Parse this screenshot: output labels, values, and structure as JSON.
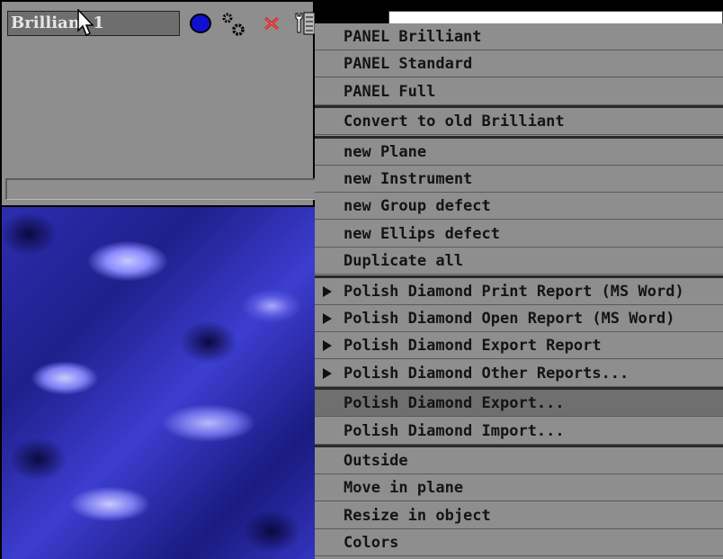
{
  "title_field": {
    "value": "Brilliant 1"
  },
  "toolbar": {
    "icons": [
      "blue-circle-icon",
      "gears-icon",
      "red-x-icon",
      "wrench-icon",
      "dots-icon"
    ]
  },
  "menu": {
    "groups": [
      {
        "items": [
          {
            "label": "PANEL Brilliant"
          },
          {
            "label": "PANEL Standard"
          },
          {
            "label": "PANEL Full"
          }
        ]
      },
      {
        "items": [
          {
            "label": "Convert to old Brilliant"
          }
        ]
      },
      {
        "items": [
          {
            "label": "new Plane"
          },
          {
            "label": "new Instrument"
          },
          {
            "label": "new Group defect"
          },
          {
            "label": "new Ellips defect"
          },
          {
            "label": "Duplicate all"
          }
        ]
      },
      {
        "items": [
          {
            "label": "Polish Diamond Print Report (MS Word)",
            "submenu": true
          },
          {
            "label": "Polish Diamond Open Report (MS Word)",
            "submenu": true
          },
          {
            "label": "Polish Diamond Export Report",
            "submenu": true
          },
          {
            "label": "Polish Diamond Other Reports...",
            "submenu": true
          }
        ]
      },
      {
        "items": [
          {
            "label": "Polish Diamond Export...",
            "highlighted": true
          },
          {
            "label": "Polish Diamond Import..."
          }
        ]
      },
      {
        "items": [
          {
            "label": "Outside"
          },
          {
            "label": "Move in plane"
          },
          {
            "label": "Resize in object"
          },
          {
            "label": "Colors"
          }
        ]
      }
    ]
  },
  "colors": {
    "panel": "#8e8e8e",
    "highlight": "#6f6f6f",
    "texture_blue": "#2d2db0"
  }
}
